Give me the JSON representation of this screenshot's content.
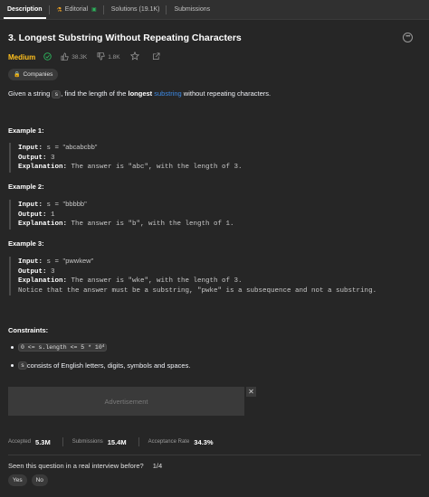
{
  "tabs": [
    {
      "label": "Description",
      "active": true
    },
    {
      "label": "Editorial",
      "icon": "flask-icon"
    },
    {
      "label": "Solutions (19.1K)"
    },
    {
      "label": "Submissions"
    }
  ],
  "problem": {
    "title": "3. Longest Substring Without Repeating Characters",
    "difficulty": "Medium",
    "likes": "38.3K",
    "dislikes": "1.8K",
    "companies_label": "Companies",
    "desc_prefix": "Given a string ",
    "desc_code": "s",
    "desc_mid": ", find the length of the ",
    "desc_bold": "longest",
    "desc_link": "substring",
    "desc_suffix": " without repeating characters."
  },
  "examples": [
    {
      "title": "Example 1:",
      "input_label": "Input:",
      "input_prefix": "s = ",
      "input_value": "\"abcabcbb\"",
      "output_label": "Output:",
      "output_value": "3",
      "explanation_label": "Explanation:",
      "explanation": "The answer is \"abc\", with the length of 3."
    },
    {
      "title": "Example 2:",
      "input_label": "Input:",
      "input_prefix": "s = ",
      "input_value": "\"bbbbb\"",
      "output_label": "Output:",
      "output_value": "1",
      "explanation_label": "Explanation:",
      "explanation": "The answer is \"b\", with the length of 1."
    },
    {
      "title": "Example 3:",
      "input_label": "Input:",
      "input_prefix": "s = ",
      "input_value": "\"pwwkew\"",
      "output_label": "Output:",
      "output_value": "3",
      "explanation_label": "Explanation:",
      "explanation": "The answer is \"wke\", with the length of 3.",
      "note": "Notice that the answer must be a substring, \"pwke\" is a subsequence and not a substring."
    }
  ],
  "constraints": {
    "title": "Constraints:",
    "c1_code": "0 <= s.length <= 5 * 10",
    "c1_sup": "4",
    "c2_code": "s",
    "c2_text": " consists of English letters, digits, symbols and spaces."
  },
  "ad": {
    "label": "Advertisement",
    "close": "✕"
  },
  "stats": {
    "accepted_label": "Accepted",
    "accepted_value": "5.3M",
    "submissions_label": "Submissions",
    "submissions_value": "15.4M",
    "rate_label": "Acceptance Rate",
    "rate_value": "34.3%"
  },
  "interview": {
    "question": "Seen this question in a real interview before?",
    "count": "1/4",
    "yes": "Yes",
    "no": "No"
  }
}
